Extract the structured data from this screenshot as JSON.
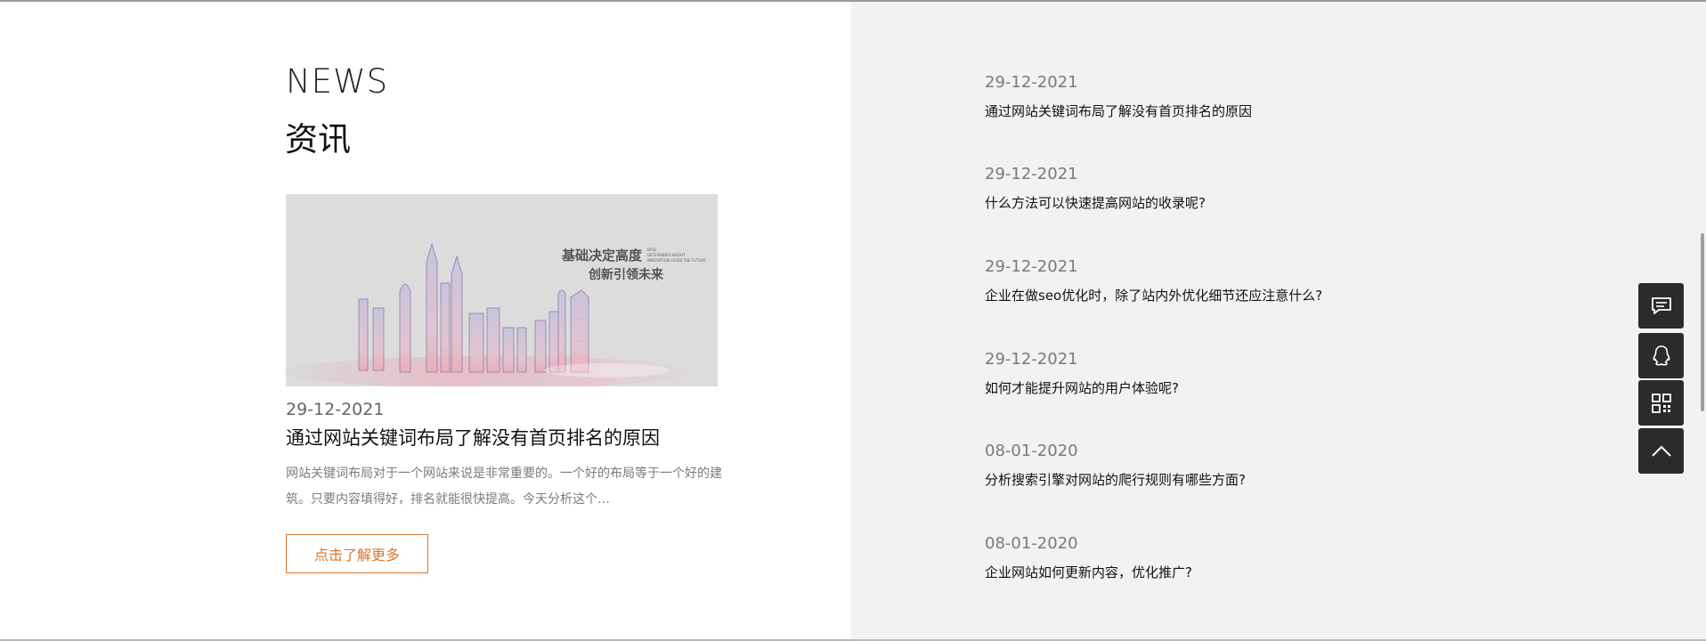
{
  "section": {
    "title_en": "NEWS",
    "title_cn": "资讯"
  },
  "featured": {
    "image_caption_line1": "基础决定高度",
    "image_caption_line2": "创新引领未来",
    "image_caption_small1": "BASE",
    "image_caption_small2": "DETERMINES HEIGHT",
    "image_caption_small3": "INNOVATION LEADS THE FUTURE",
    "date": "29-12-2021",
    "title": "通过网站关键词布局了解没有首页排名的原因",
    "summary": "网站关键词布局对于一个网站来说是非常重要的。一个好的布局等于一个好的建筑。只要内容填得好，排名就能很快提高。今天分析这个…",
    "more_label": "点击了解更多"
  },
  "news_list": [
    {
      "date": "29-12-2021",
      "title": "通过网站关键词布局了解没有首页排名的原因"
    },
    {
      "date": "29-12-2021",
      "title": "什么方法可以快速提高网站的收录呢?"
    },
    {
      "date": "29-12-2021",
      "title": "企业在做seo优化时，除了站内外优化细节还应注意什么?"
    },
    {
      "date": "29-12-2021",
      "title": "如何才能提升网站的用户体验呢?"
    },
    {
      "date": "08-01-2020",
      "title": "分析搜索引擎对网站的爬行规则有哪些方面?"
    },
    {
      "date": "08-01-2020",
      "title": "企业网站如何更新内容，优化推广?"
    }
  ],
  "side_tools": [
    {
      "icon": "message-icon"
    },
    {
      "icon": "qq-icon"
    },
    {
      "icon": "qrcode-icon"
    },
    {
      "icon": "back-to-top-icon"
    }
  ],
  "colors": {
    "accent": "#d3772f",
    "right_panel_bg": "#f1f2f1",
    "tool_bg": "#2b2b2b"
  }
}
